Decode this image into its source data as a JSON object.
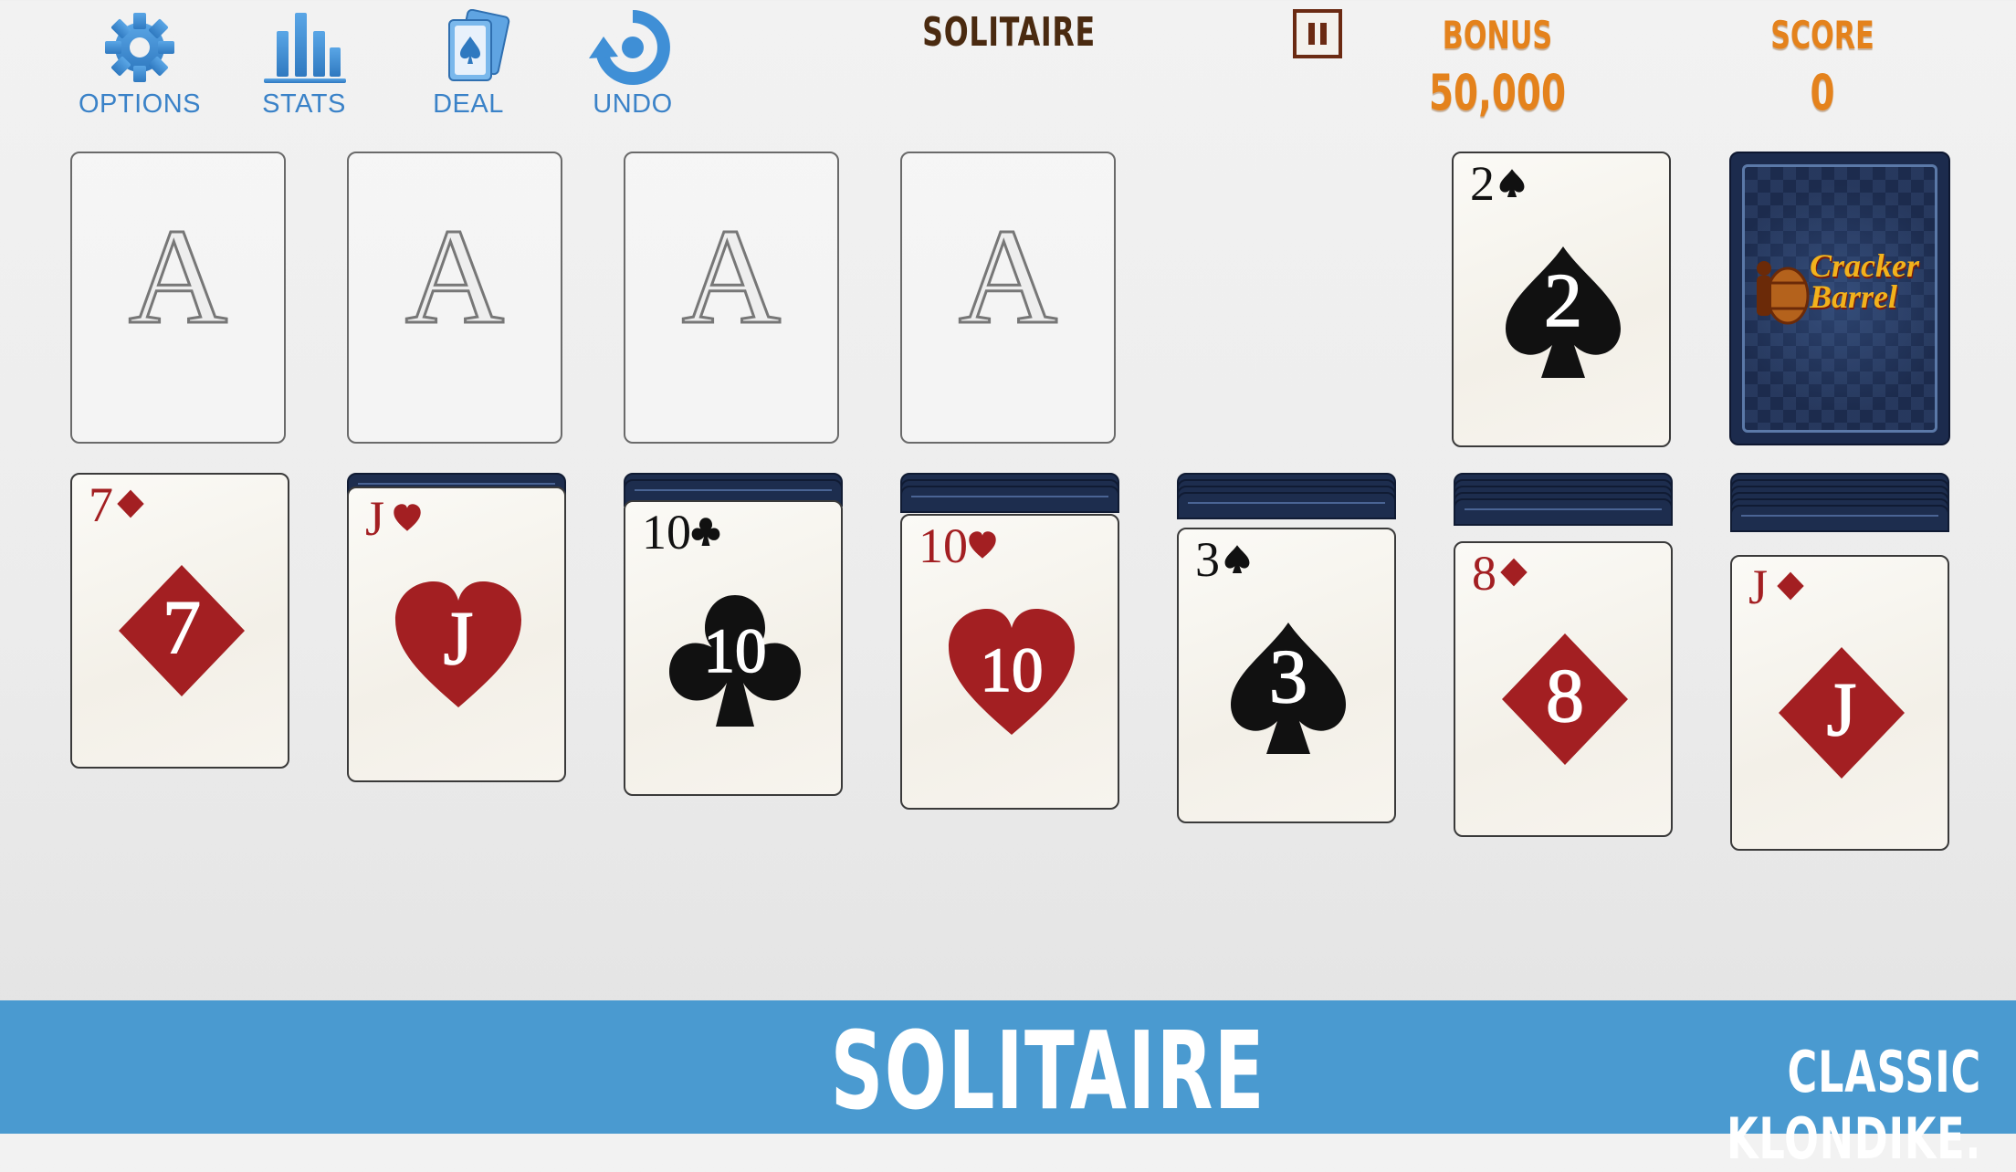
{
  "toolbar": {
    "options_label": "OPTIONS",
    "stats_label": "STATS",
    "deal_label": "DEAL",
    "undo_label": "UNDO"
  },
  "header": {
    "title": "SOLITAIRE",
    "bonus_label": "BONUS",
    "bonus_value": "50,000",
    "score_label": "SCORE",
    "score_value": "0"
  },
  "foundations": [
    {
      "placeholder": "A"
    },
    {
      "placeholder": "A"
    },
    {
      "placeholder": "A"
    },
    {
      "placeholder": "A"
    }
  ],
  "waste": {
    "rank": "2",
    "suit": "spade",
    "color": "black"
  },
  "stock": {
    "back": "cracker-barrel-logo",
    "logo_text": "Cracker Barrel"
  },
  "tableau": [
    {
      "hidden": 0,
      "rank": "7",
      "suit": "diamond",
      "color": "red"
    },
    {
      "hidden": 1,
      "rank": "J",
      "suit": "heart",
      "color": "red"
    },
    {
      "hidden": 2,
      "rank": "10",
      "suit": "club",
      "color": "black"
    },
    {
      "hidden": 3,
      "rank": "10",
      "suit": "heart",
      "color": "red"
    },
    {
      "hidden": 4,
      "rank": "3",
      "suit": "spade",
      "color": "black"
    },
    {
      "hidden": 5,
      "rank": "8",
      "suit": "diamond",
      "color": "red"
    },
    {
      "hidden": 6,
      "rank": "J",
      "suit": "diamond",
      "color": "red"
    }
  ],
  "banner": {
    "title": "SOLITAIRE",
    "tagline": "CLASSIC KLONDIKE."
  },
  "colors": {
    "red": "#a31f22",
    "black": "#111111",
    "accent": "#3a82c8",
    "orange": "#e4821c",
    "banner": "#4a9ad0"
  }
}
